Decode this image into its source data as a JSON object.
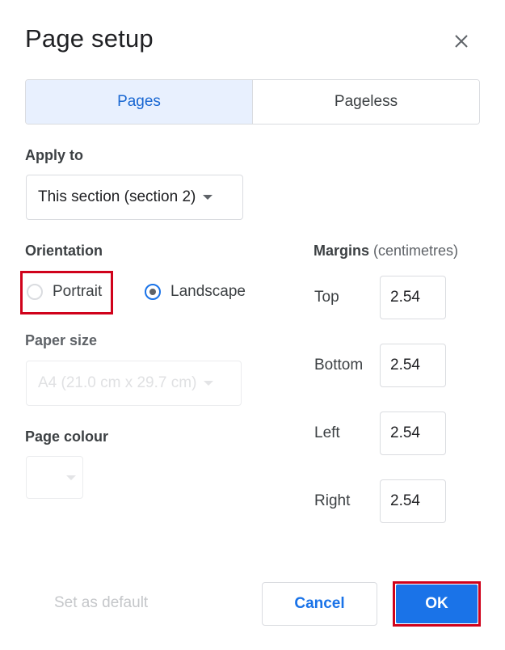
{
  "dialog": {
    "title": "Page setup"
  },
  "tabs": [
    {
      "label": "Pages",
      "active": true
    },
    {
      "label": "Pageless",
      "active": false
    }
  ],
  "apply_to": {
    "label": "Apply to",
    "value": "This section (section 2)"
  },
  "orientation": {
    "label": "Orientation",
    "options": [
      {
        "label": "Portrait",
        "checked": false
      },
      {
        "label": "Landscape",
        "checked": true
      }
    ]
  },
  "paper_size": {
    "label": "Paper size",
    "value": "A4 (21.0 cm x 29.7 cm)"
  },
  "page_colour": {
    "label": "Page colour"
  },
  "margins": {
    "label": "Margins",
    "unit": "(centimetres)",
    "fields": [
      {
        "label": "Top",
        "value": "2.54"
      },
      {
        "label": "Bottom",
        "value": "2.54"
      },
      {
        "label": "Left",
        "value": "2.54"
      },
      {
        "label": "Right",
        "value": "2.54"
      }
    ]
  },
  "footer": {
    "set_default": "Set as default",
    "cancel": "Cancel",
    "ok": "OK"
  },
  "colors": {
    "accent": "#1a73e8",
    "highlight": "#d0021b"
  },
  "icons": {
    "close": "close-icon",
    "dropdown": "caret-down-icon"
  }
}
